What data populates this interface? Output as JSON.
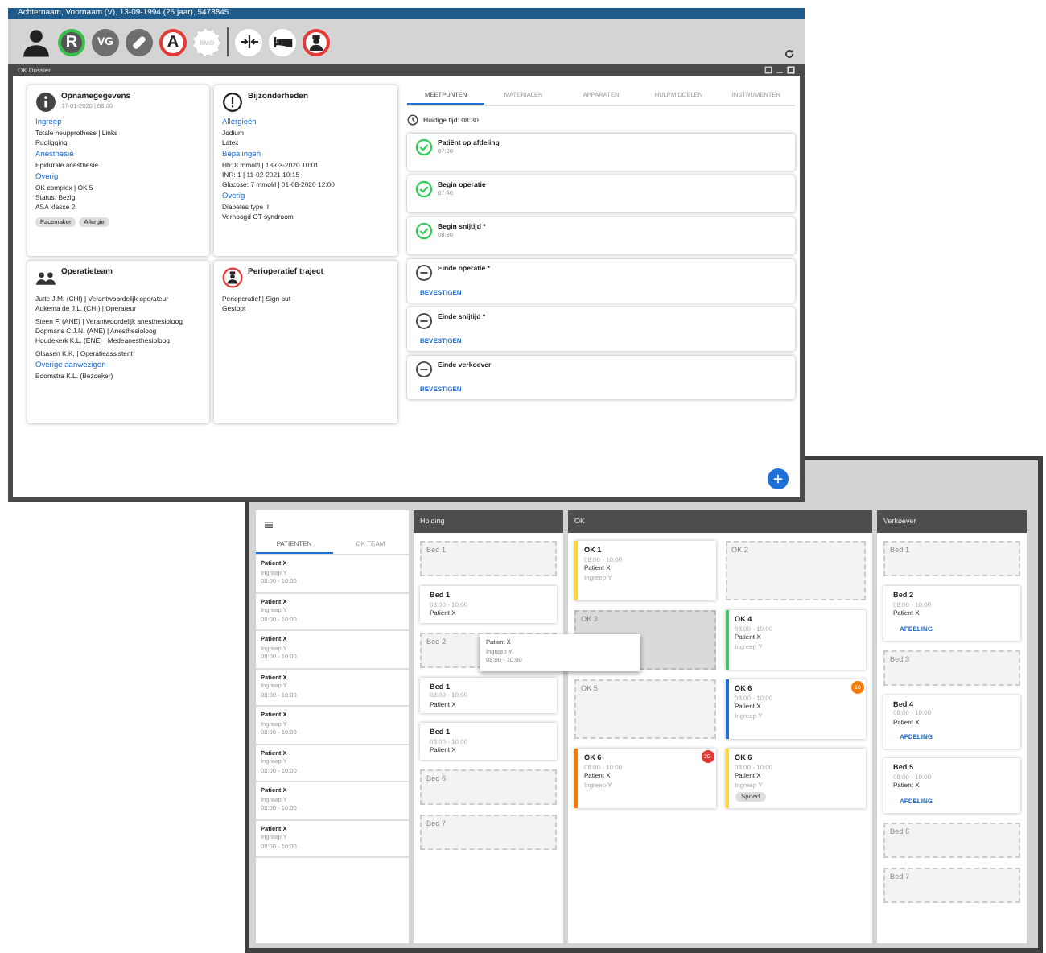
{
  "window": {
    "title": "Achternaam, Voornaam (V), 13-09-1994 (25 jaar), 5478845"
  },
  "toolbar": [
    {
      "kind": "avatar"
    },
    {
      "kind": "ringed",
      "text": "R"
    },
    {
      "kind": "filled",
      "text": "VG"
    },
    {
      "kind": "pill"
    },
    {
      "kind": "warning",
      "text": "A"
    },
    {
      "kind": "faint",
      "text": "BMO"
    },
    {
      "kind": "divider"
    },
    {
      "kind": "arrows"
    },
    {
      "kind": "bed"
    },
    {
      "kind": "doctor"
    }
  ],
  "dossier": {
    "title": "OK Dossier",
    "cards": [
      {
        "kind": "info",
        "title": "Opnamegegevens",
        "subtitle": "17-01-2020 | 08:00",
        "sections": [
          {
            "heading": "Ingreep",
            "lines": [
              "Totale heupprothese | Links",
              "Rugligging"
            ]
          },
          {
            "heading": "Anesthesie",
            "lines": [
              "Epidurale anesthesie"
            ]
          },
          {
            "heading": "Overig",
            "lines": [
              "OK complex | OK 5",
              "Status: Bezig",
              "ASA klasse 2"
            ]
          }
        ],
        "chips": [
          "Pacemaker",
          "Allergie"
        ]
      },
      {
        "kind": "alert",
        "title": "Bijzonderheden",
        "sections": [
          {
            "heading": "Allergieën",
            "lines": [
              "Jodium",
              "Latex"
            ]
          },
          {
            "heading": "Bepalingen",
            "lines": [
              "Hb: 8 mmol/l | 18-03-2020 10:01",
              "INR: 1 | 11-02-2021 10:15",
              "Glucose: 7 mmol/l | 01-08-2020 12:00"
            ]
          },
          {
            "heading": "Overig",
            "lines": [
              "Diabetes type II",
              "Verhoogd OT syndroom"
            ]
          }
        ]
      },
      {
        "kind": "team",
        "title": "Operatieteam",
        "sections": [
          {
            "lines": [
              "Jutte J.M. (CHI) | Verantwoordelijk operateur",
              "Aukema de J.L. (CHI) | Operateur"
            ]
          },
          {
            "lines": [
              "Steen F. (ANE) | Verantwoordelijk anesthesioloog",
              "Dopmans C.J.N. (ANE) | Anesthesioloog",
              "Houdekerk K.L. (ENE) | Medeanesthesioloog"
            ]
          },
          {
            "lines": [
              "Olsasen K.K. | Operatieassistent"
            ]
          },
          {
            "heading": "Overige aanwezigen",
            "lines": [
              "Boomstra K.L. (Bezoeker)"
            ]
          }
        ]
      },
      {
        "kind": "trajectory",
        "title": "Perioperatief traject",
        "sections": [
          {
            "lines": [
              "Perioperatief | Sign out",
              "Gestopt"
            ]
          }
        ]
      }
    ],
    "tabs": [
      {
        "label": "MEETPUNTEN",
        "selected": true
      },
      {
        "label": "MATERIALEN",
        "selected": false
      },
      {
        "label": "APPARATEN",
        "selected": false
      },
      {
        "label": "HULPMIDDELEN",
        "selected": false
      },
      {
        "label": "INSTRUMENTEN",
        "selected": false
      }
    ],
    "current_time": "Huidige tijd: 08:30",
    "milestones": [
      {
        "label": "Patiënt op afdeling",
        "done": true,
        "time": "07:30"
      },
      {
        "label": "Begin operatie",
        "done": true,
        "time": "07:40"
      },
      {
        "label": "Begin snijtijd *",
        "done": true,
        "time": "08:30"
      },
      {
        "label": "Einde operatie *",
        "done": false,
        "action": "BEVESTIGEN"
      },
      {
        "label": "Einde snijtijd *",
        "done": false,
        "action": "BEVESTIGEN"
      },
      {
        "label": "Einde verkoever",
        "done": false,
        "action": "BEVESTIGEN"
      }
    ]
  },
  "planboard": {
    "sidebar": {
      "tabs": [
        {
          "label": "PATIENTEN",
          "selected": true
        },
        {
          "label": "OK TEAM",
          "selected": false
        }
      ],
      "patients": [
        {
          "name": "Patient X",
          "procedure": "Ingreep Y",
          "time": "08:00 - 10:00"
        },
        {
          "name": "Patient X",
          "procedure": "Ingreep Y",
          "time": "08:00 - 10:00"
        },
        {
          "name": "Patient X",
          "procedure": "Ingreep Y",
          "time": "08:00 - 10:00"
        },
        {
          "name": "Patient X",
          "procedure": "Ingreep Y",
          "time": "08:00 - 10:00"
        },
        {
          "name": "Patient X",
          "procedure": "Ingreep Y",
          "time": "08:00 - 10:00"
        },
        {
          "name": "Patient X",
          "procedure": "Ingreep Y",
          "time": "08:00 - 10:00"
        },
        {
          "name": "Patient X",
          "procedure": "Ingreep Y",
          "time": "08:00 - 10:00"
        },
        {
          "name": "Patient X",
          "procedure": "Ingreep Y",
          "time": "08:00 - 10:00"
        }
      ]
    },
    "columns": [
      {
        "title": "Holding",
        "slots": [
          {
            "kind": "empty",
            "label": "Bed 1"
          },
          {
            "kind": "patient",
            "label": "Bed 1",
            "time": "08:00 - 10:00",
            "patient": "Patient X"
          },
          {
            "kind": "empty",
            "label": "Bed 2"
          },
          {
            "kind": "patient",
            "label": "Bed 1",
            "time": "08:00 - 10:00",
            "patient": "Patient X"
          },
          {
            "kind": "patient",
            "label": "Bed 1",
            "time": "08:00 - 10:00",
            "patient": "Patient X"
          },
          {
            "kind": "empty",
            "label": "Bed 6"
          },
          {
            "kind": "empty",
            "label": "Bed 7"
          }
        ]
      },
      {
        "title": "OK",
        "slots": [
          {
            "kind": "patient",
            "label": "OK 1",
            "time": "08:00 - 10:00",
            "patient": "Patient X",
            "procedure": "Ingreep Y",
            "color": "#fdd835"
          },
          {
            "kind": "empty",
            "label": "OK 2",
            "highlighted": false
          },
          {
            "kind": "empty",
            "label": "OK 3",
            "highlighted": true
          },
          {
            "kind": "patient",
            "label": "OK 4",
            "time": "08:00 - 10:00",
            "patient": "Patient X",
            "procedure": "Ingreep Y",
            "color": "#43c46a"
          },
          {
            "kind": "empty",
            "label": "OK 5",
            "highlighted": false
          },
          {
            "kind": "patient",
            "label": "OK 6",
            "time": "08:00 - 10:00",
            "patient": "Patient X",
            "procedure": "Ingreep Y",
            "color": "#1e6fd6",
            "badge": {
              "text": "10",
              "color": "#f57c00"
            }
          },
          {
            "kind": "patient",
            "label": "OK 6",
            "time": "08:00 - 10:00",
            "patient": "Patient X",
            "procedure": "Ingreep Y",
            "color": "#f57c00",
            "badge": {
              "text": "20",
              "color": "#e53935"
            }
          },
          {
            "kind": "patient",
            "label": "OK 6",
            "time": "08:00 - 10:00",
            "patient": "Patient X",
            "procedure": "Ingreep Y",
            "color": "#fdd835",
            "chip": "Spoed"
          }
        ]
      },
      {
        "title": "Verkoever",
        "slots": [
          {
            "kind": "empty",
            "label": "Bed 1"
          },
          {
            "kind": "patient",
            "label": "Bed 2",
            "time": "08:00 - 10:00",
            "patient": "Patient X",
            "action": "AFDELING"
          },
          {
            "kind": "empty",
            "label": "Bed 3"
          },
          {
            "kind": "patient",
            "label": "Bed 4",
            "time": "08:00 - 10:00",
            "patient": "Patient X",
            "action": "AFDELING"
          },
          {
            "kind": "patient",
            "label": "Bed 5",
            "time": "08:00 - 10:00",
            "patient": "Patient X",
            "action": "AFDELING"
          },
          {
            "kind": "empty",
            "label": "Bed 6"
          },
          {
            "kind": "empty",
            "label": "Bed 7"
          }
        ]
      }
    ],
    "drag_preview": {
      "name": "Patient X",
      "procedure": "Ingreep Y",
      "time": "08:00 - 10:00"
    }
  }
}
